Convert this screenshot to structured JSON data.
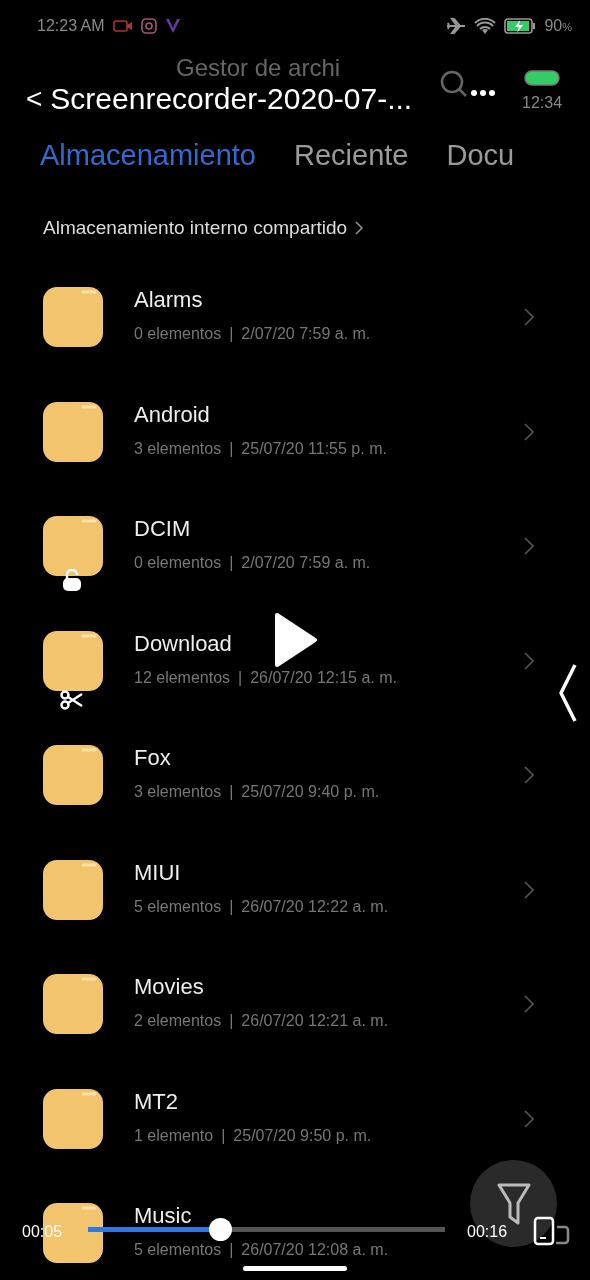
{
  "status_bar": {
    "time": "12:23 AM",
    "battery": "90",
    "battery_unit": "%"
  },
  "header": {
    "back": "<",
    "title": "Screenrecorder-2020-07-...",
    "app_title": "Gestor de archi",
    "mini_player_time": "12:34"
  },
  "tabs": [
    {
      "label": "Almacenamiento",
      "selected": true
    },
    {
      "label": "Reciente",
      "selected": false
    },
    {
      "label": "Docu",
      "selected": false
    }
  ],
  "breadcrumb": "Almacenamiento interno compartido",
  "folders": [
    {
      "name": "Alarms",
      "count": "0 elementos",
      "separator": "|",
      "date": "2/07/20 7:59 a. m."
    },
    {
      "name": "Android",
      "count": "3 elementos",
      "separator": "|",
      "date": "25/07/20 11:55 p. m."
    },
    {
      "name": "DCIM",
      "count": "0 elementos",
      "separator": "|",
      "date": "2/07/20 7:59 a. m."
    },
    {
      "name": "Download",
      "count": "12 elementos",
      "separator": "|",
      "date": "26/07/20 12:15 a. m."
    },
    {
      "name": "Fox",
      "count": "3 elementos",
      "separator": "|",
      "date": "25/07/20 9:40 p. m."
    },
    {
      "name": "MIUI",
      "count": "5 elementos",
      "separator": "|",
      "date": "26/07/20 12:22 a. m."
    },
    {
      "name": "Movies",
      "count": "2 elementos",
      "separator": "|",
      "date": "26/07/20 12:21 a. m."
    },
    {
      "name": "MT2",
      "count": "1 elemento",
      "separator": "|",
      "date": "25/07/20 9:50 p. m."
    },
    {
      "name": "Music",
      "count": "5 elementos",
      "separator": "|",
      "date": "26/07/20 12:08 a. m."
    }
  ],
  "player": {
    "elapsed": "00:05",
    "duration": "00:16",
    "level": 0.37
  }
}
